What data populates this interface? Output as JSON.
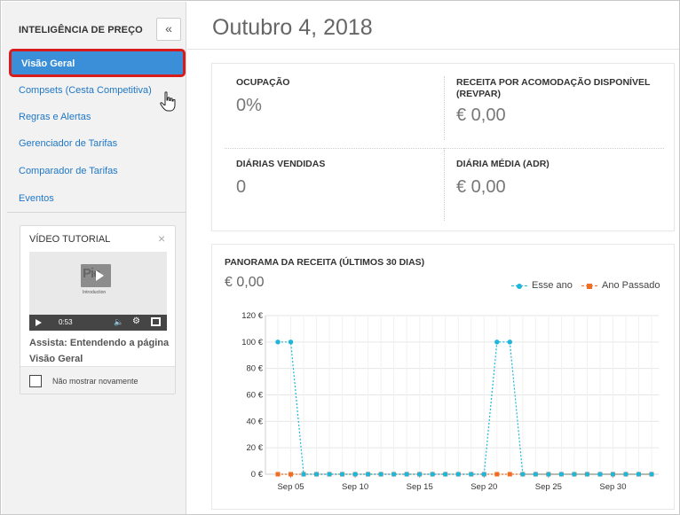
{
  "sidebar": {
    "title": "INTELIGÊNCIA DE PREÇO",
    "collapse_glyph": "«",
    "items": [
      {
        "label": "Visão Geral",
        "active": true
      },
      {
        "label": "Compsets (Cesta Competitiva)"
      },
      {
        "label": "Regras e Alertas"
      },
      {
        "label": "Gerenciador de Tarifas"
      },
      {
        "label": "Comparador de Tarifas"
      },
      {
        "label": "Eventos"
      }
    ],
    "active_highlight_color": "#d81c1c",
    "active_bg": "#3a8fd8"
  },
  "tutorial": {
    "title": "VÍDEO TUTORIAL",
    "close_glyph": "×",
    "video": {
      "thumb_text": "Pic",
      "caption": "Introduction",
      "time": "0:53"
    },
    "link": "Assista: Entendendo a página Visão Geral",
    "checkbox_label": "Não mostrar novamente",
    "checked": false
  },
  "main": {
    "title": "Outubro 4, 2018",
    "kpis": [
      {
        "label": "OCUPAÇÃO",
        "value": "0%"
      },
      {
        "label": "RECEITA POR ACOMODAÇÃO DISPONÍVEL (REVPAR)",
        "value": "€ 0,00"
      },
      {
        "label": "DIÁRIAS VENDIDAS",
        "value": "0"
      },
      {
        "label": "DIÁRIA MÉDIA (ADR)",
        "value": "€ 0,00"
      }
    ]
  },
  "chart": {
    "title": "PANORAMA DA RECEITA (ÚLTIMOS 30 DIAS)",
    "total": "€ 0,00"
  },
  "chart_data": {
    "type": "line",
    "x": [
      "Sep 04",
      "Sep 05",
      "Sep 06",
      "Sep 07",
      "Sep 08",
      "Sep 09",
      "Sep 10",
      "Sep 11",
      "Sep 12",
      "Sep 13",
      "Sep 14",
      "Sep 15",
      "Sep 16",
      "Sep 17",
      "Sep 18",
      "Sep 19",
      "Sep 20",
      "Sep 21",
      "Sep 22",
      "Sep 23",
      "Sep 24",
      "Sep 25",
      "Sep 26",
      "Sep 27",
      "Sep 28",
      "Sep 29",
      "Sep 30",
      "Oct 01",
      "Oct 02",
      "Oct 03"
    ],
    "x_tick_labels": [
      "Sep 05",
      "Sep 10",
      "Sep 15",
      "Sep 20",
      "Sep 25",
      "Sep 30"
    ],
    "y_tick_labels": [
      "120 €",
      "100 €",
      "80 €",
      "60 €",
      "40 €",
      "20 €",
      "0 €"
    ],
    "ylim": [
      0,
      120
    ],
    "grid": true,
    "legend_position": "top-right",
    "series": [
      {
        "name": "Esse ano",
        "color": "#1fb6dc",
        "values": [
          100,
          100,
          0,
          0,
          0,
          0,
          0,
          0,
          0,
          0,
          0,
          0,
          0,
          0,
          0,
          0,
          0,
          100,
          100,
          0,
          0,
          0,
          0,
          0,
          0,
          0,
          0,
          0,
          0,
          0
        ]
      },
      {
        "name": "Ano Passado",
        "color": "#f26c21",
        "values": [
          0,
          0,
          0,
          0,
          0,
          0,
          0,
          0,
          0,
          0,
          0,
          0,
          0,
          0,
          0,
          0,
          0,
          0,
          0,
          0,
          0,
          0,
          0,
          0,
          0,
          0,
          0,
          0,
          0,
          0
        ]
      }
    ]
  }
}
